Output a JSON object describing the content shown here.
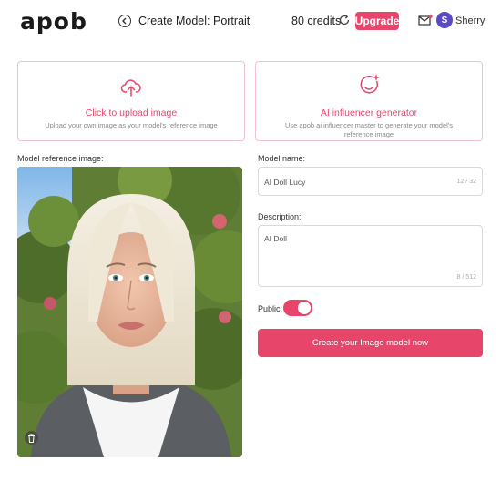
{
  "header": {
    "logo": "apob",
    "title": "Create Model: Portrait",
    "credits": "80 credits",
    "upgrade_label": "Upgrade",
    "avatar_initial": "S",
    "username": "Sherry"
  },
  "cards": {
    "upload": {
      "title": "Click to upload image",
      "description": "Upload your own image as your model's reference image",
      "icon": "cloud-upload-icon"
    },
    "ai": {
      "title": "AI influencer generator",
      "description": "Use apob ai influencer master to generate your model's reference image",
      "icon": "smiley-sparkle-icon"
    }
  },
  "form": {
    "reference_label": "Model reference image:",
    "name_label": "Model name:",
    "name_value": "AI Doll Lucy",
    "name_counter": "12 / 32",
    "description_label": "Description:",
    "description_value": "AI Doll",
    "description_counter": "8 / 512",
    "public_label": "Public:",
    "public_on": true,
    "submit_label": "Create your Image model now"
  },
  "colors": {
    "accent": "#e8456b",
    "card_border": "#f0c2cd",
    "avatar": "#5b4ac6"
  }
}
